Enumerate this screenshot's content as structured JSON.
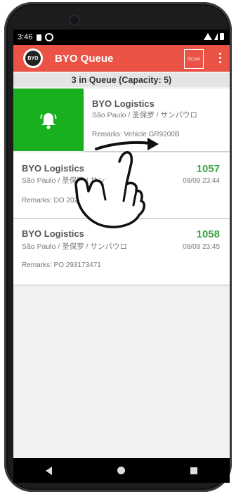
{
  "statusbar": {
    "time": "3:46"
  },
  "appbar": {
    "logo_text": "BYO",
    "title": "BYO Queue",
    "scan_label": "SCAN"
  },
  "queue_header": "3 in Queue (Capacity: 5)",
  "items": [
    {
      "name": "BYO Logistics",
      "location": "São Paulo / 圣保罗 / サンパウロ",
      "remarks": "Remarks: Vehicle GR9200B",
      "number": "",
      "time": ""
    },
    {
      "name": "BYO Logistics",
      "location": "São Paulo / 圣保罗 / サンパウロ",
      "remarks": "Remarks: DO 20210909A-12",
      "number": "1057",
      "time": "08/09 23:44"
    },
    {
      "name": "BYO Logistics",
      "location": "São Paulo / 圣保罗 / サンパウロ",
      "remarks": "Remarks: PO 293173471",
      "number": "1058",
      "time": "08/09 23:45"
    }
  ],
  "colors": {
    "appbar": "#ea5345",
    "swipe_action": "#19b020",
    "queue_number": "#3fa54a"
  },
  "icons": {
    "swipe_action": "bell-icon",
    "gesture": "swipe-right-hand-icon"
  }
}
